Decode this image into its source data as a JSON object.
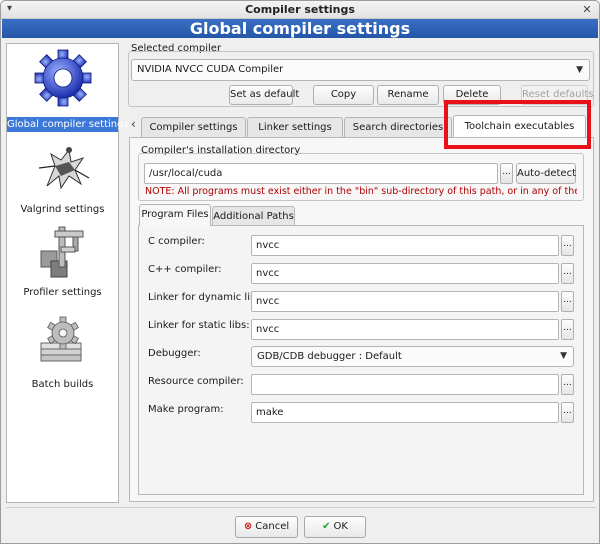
{
  "window": {
    "title": "Compiler settings"
  },
  "banner": {
    "text": "Global compiler settings"
  },
  "sidebar": {
    "items": [
      {
        "label": "Global compiler settings",
        "icon": "gear-icon",
        "selected": true
      },
      {
        "label": "Valgrind settings",
        "icon": "valgrind-icon",
        "selected": false
      },
      {
        "label": "Profiler settings",
        "icon": "profiler-icon",
        "selected": false
      },
      {
        "label": "Batch builds",
        "icon": "batch-builds-icon",
        "selected": false
      }
    ]
  },
  "selected_compiler": {
    "group_label": "Selected compiler",
    "value": "NVIDIA NVCC CUDA Compiler",
    "buttons": {
      "set_default": "Set as default",
      "copy": "Copy",
      "rename": "Rename",
      "delete": "Delete",
      "reset": "Reset defaults"
    }
  },
  "tabs": {
    "scroll_left": "‹",
    "items": [
      {
        "label": "Compiler settings",
        "active": false
      },
      {
        "label": "Linker settings",
        "active": false
      },
      {
        "label": "Search directories",
        "active": false
      },
      {
        "label": "Toolchain executables",
        "active": true
      }
    ]
  },
  "install_dir": {
    "group_label": "Compiler's installation directory",
    "value": "/usr/local/cuda",
    "browse": "...",
    "auto_detect": "Auto-detect",
    "note": "NOTE: All programs must exist either in the \"bin\" sub-directory of this path, or in any of the \"Additional"
  },
  "subtabs": {
    "items": [
      {
        "label": "Program Files",
        "active": true
      },
      {
        "label": "Additional Paths",
        "active": false
      }
    ]
  },
  "programs": [
    {
      "label": "C compiler:",
      "value": "nvcc",
      "type": "text"
    },
    {
      "label": "C++ compiler:",
      "value": "nvcc",
      "type": "text"
    },
    {
      "label": "Linker for dynamic libs:",
      "value": "nvcc",
      "type": "text"
    },
    {
      "label": "Linker for static libs:",
      "value": "nvcc",
      "type": "text"
    },
    {
      "label": "Debugger:",
      "value": "GDB/CDB debugger : Default",
      "type": "select"
    },
    {
      "label": "Resource compiler:",
      "value": "",
      "type": "text"
    },
    {
      "label": "Make program:",
      "value": "make",
      "type": "text"
    }
  ],
  "browse_label": "...",
  "dialog": {
    "cancel": "Cancel",
    "ok": "OK"
  },
  "colors": {
    "banner": "#2f63b8",
    "highlight": "#e8111a",
    "selection": "#3b78d8",
    "note": "#b00000"
  }
}
